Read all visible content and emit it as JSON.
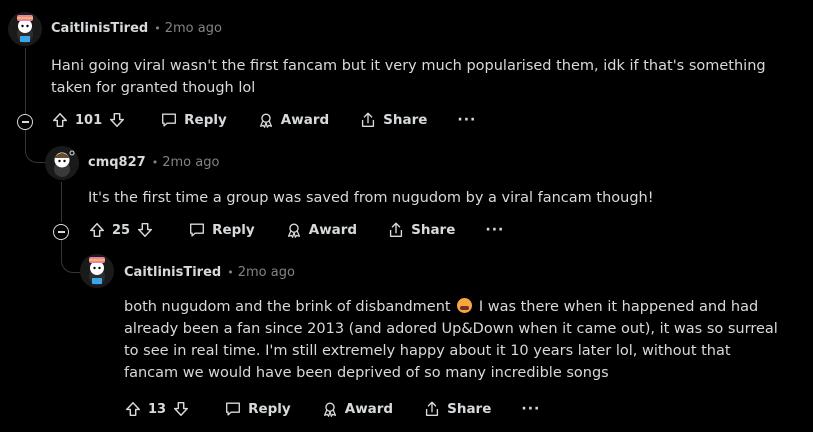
{
  "comments": [
    {
      "author": "CaitlinisTired",
      "time": "2mo ago",
      "text": "Hani going viral wasn't the first fancam but it very much popularised them, idk if that's something taken for granted though lol",
      "votes": "101",
      "reply": "Reply",
      "award": "Award",
      "share": "Share",
      "more": "···"
    },
    {
      "author": "cmq827",
      "time": "2mo ago",
      "text": "It's the first time a group was saved from nugudom by a viral fancam though!",
      "votes": "25",
      "reply": "Reply",
      "award": "Award",
      "share": "Share",
      "more": "···"
    },
    {
      "author": "CaitlinisTired",
      "time": "2mo ago",
      "text_before_emoji": "both nugudom and the brink of disbandment",
      "emoji": "crying-face-emoji",
      "text_after_emoji": " I was there when it happened and had already been a fan since 2013 (and adored Up&Down when it came out), it was so surreal to see in real time. I'm still extremely happy about it 10 years later lol, without that fancam we would have been deprived of so many incredible songs",
      "votes": "13",
      "reply": "Reply",
      "award": "Award",
      "share": "Share",
      "more": "···"
    }
  ]
}
